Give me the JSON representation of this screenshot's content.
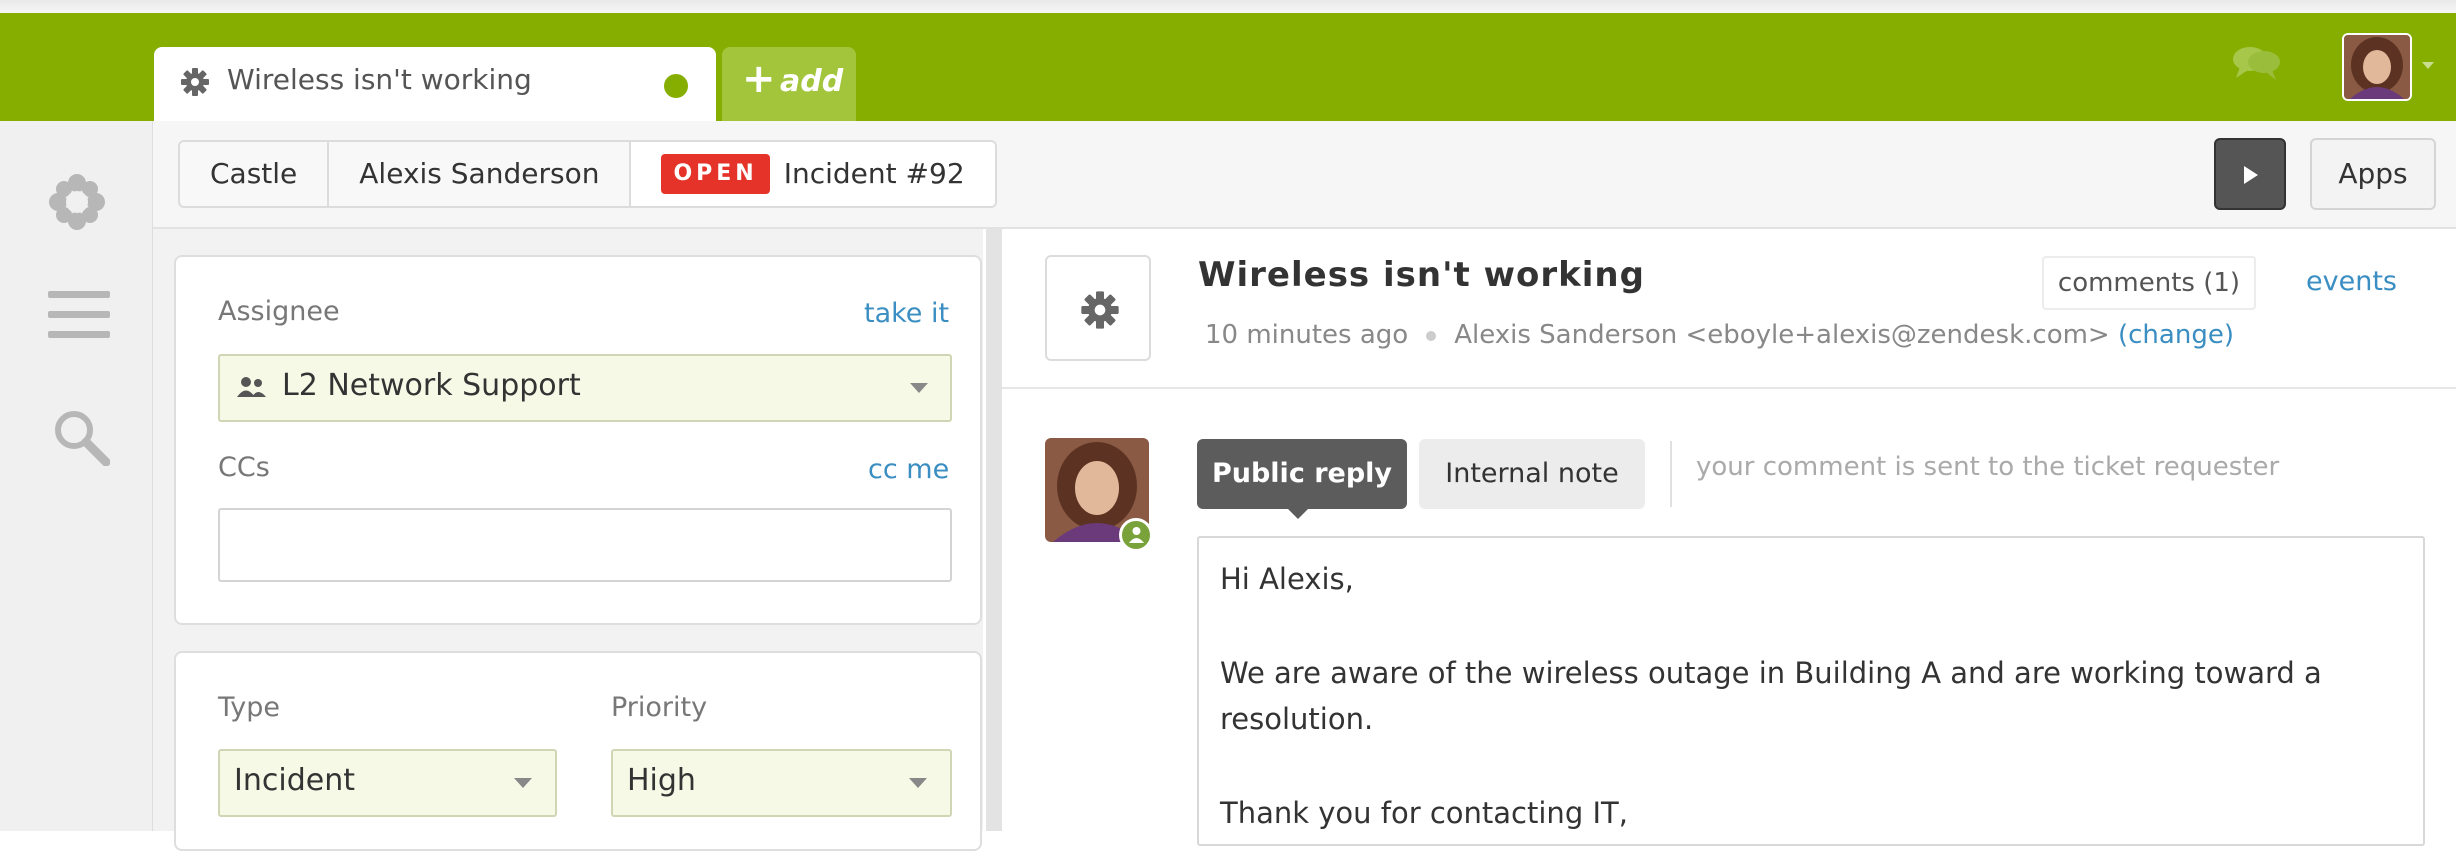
{
  "header": {
    "active_tab_title": "Wireless isn't working",
    "add_tab_label": "add",
    "icons": {
      "tab_icon": "gear-icon",
      "chat": "chat-bubbles-icon",
      "avatar": "user-avatar",
      "caret": "caret-down-icon"
    },
    "colors": {
      "brand_green": "#86ae00",
      "add_tab": "#a2c53b"
    }
  },
  "leftnav": {
    "icons": [
      "zendesk-logo-icon",
      "menu-icon",
      "search-icon"
    ]
  },
  "breadcrumb": {
    "items": [
      "Castle",
      "Alexis Sanderson"
    ],
    "status_badge": "OPEN",
    "ticket_label": "Incident #92",
    "apps_label": "Apps",
    "play_icon": "play-icon",
    "colors": {
      "open_badge": "#e5332a"
    }
  },
  "properties": {
    "assignee_label": "Assignee",
    "take_it": "take it",
    "assignee_value": "L2 Network Support",
    "ccs_label": "CCs",
    "cc_me": "cc me",
    "cc_value": "",
    "type_label": "Type",
    "type_value": "Incident",
    "priority_label": "Priority",
    "priority_value": "High"
  },
  "ticket": {
    "title": "Wireless isn't working",
    "time": "10 minutes ago",
    "requester": "Alexis Sanderson <eboyle+alexis@zendesk.com>",
    "change_link": "(change)",
    "comments_tab": "comments (1)",
    "events_tab": "events"
  },
  "reply": {
    "public_reply": "Public reply",
    "internal_note": "Internal note",
    "hint": "your comment is sent to the ticket requester",
    "lines": [
      "Hi Alexis,",
      "We are aware of the wireless outage in Building A and are working toward a",
      "resolution.",
      "Thank you for contacting IT,"
    ]
  }
}
